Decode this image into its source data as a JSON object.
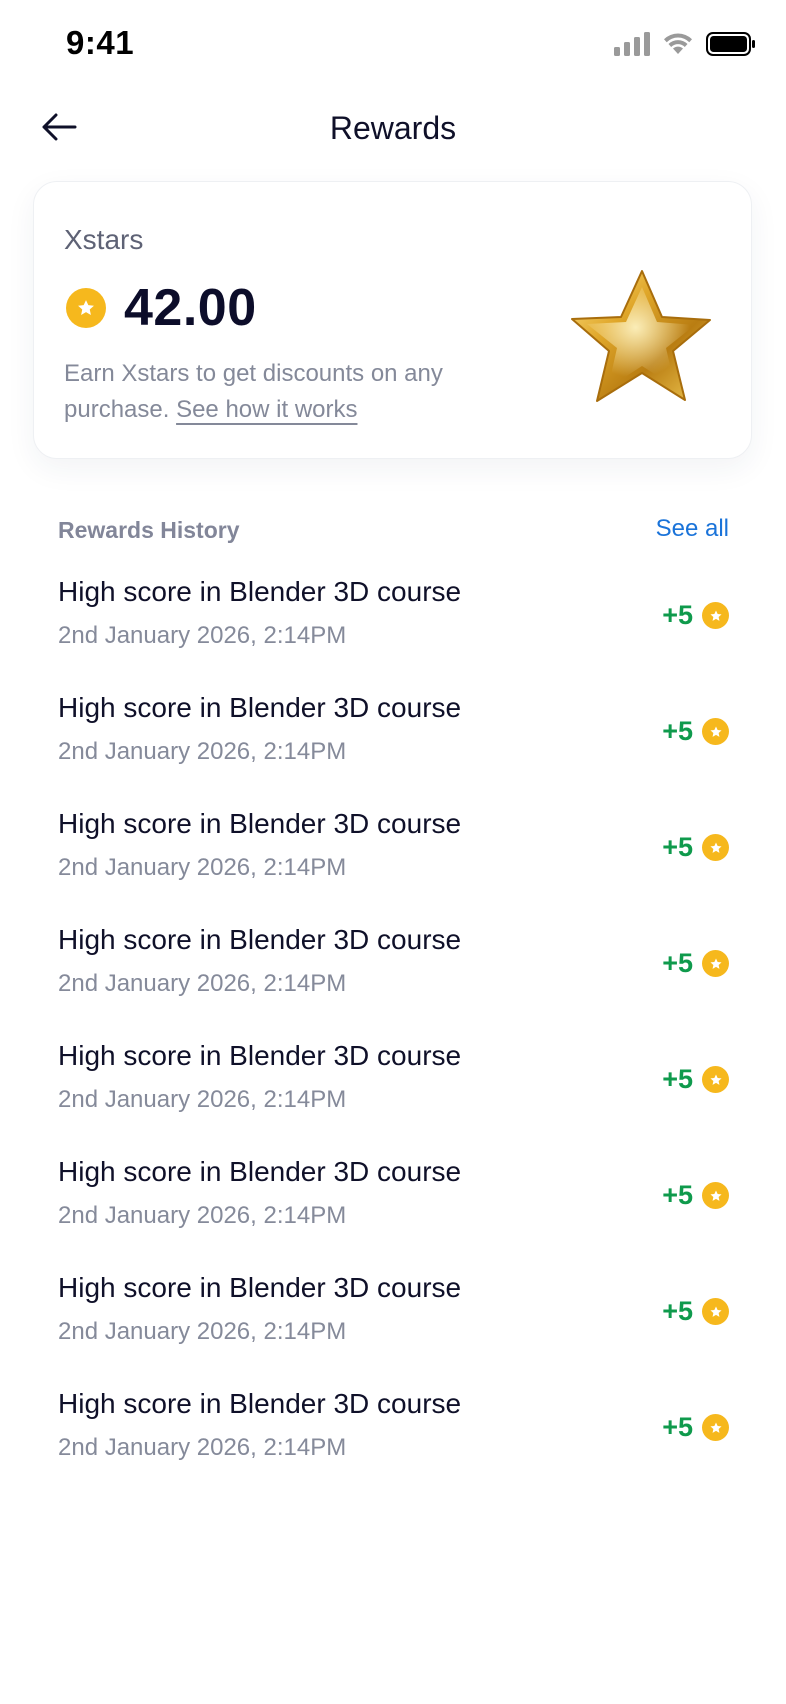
{
  "status_bar": {
    "time": "9:41",
    "icons": [
      "cellular-signal-icon",
      "wifi-icon",
      "battery-icon"
    ]
  },
  "nav": {
    "back_icon": "arrow-left-icon",
    "title": "Rewards"
  },
  "balance_card": {
    "label": "Xstars",
    "coin_icon": "star-coin-icon",
    "amount": "42.00",
    "description": "Earn Xstars to get discounts on any purchase.",
    "link_text": "See how it works",
    "illustration": "gold-star-3d-icon"
  },
  "history": {
    "title": "Rewards History",
    "see_all_label": "See all",
    "items": [
      {
        "title": "High score in Blender 3D course",
        "date": "2nd January 2026, 2:14PM",
        "amount": "+5"
      },
      {
        "title": "High score in Blender 3D course",
        "date": "2nd January 2026, 2:14PM",
        "amount": "+5"
      },
      {
        "title": "High score in Blender 3D course",
        "date": "2nd January 2026, 2:14PM",
        "amount": "+5"
      },
      {
        "title": "High score in Blender 3D course",
        "date": "2nd January 2026, 2:14PM",
        "amount": "+5"
      },
      {
        "title": "High score in Blender 3D course",
        "date": "2nd January 2026, 2:14PM",
        "amount": "+5"
      },
      {
        "title": "High score in Blender 3D course",
        "date": "2nd January 2026, 2:14PM",
        "amount": "+5"
      },
      {
        "title": "High score in Blender 3D course",
        "date": "2nd January 2026, 2:14PM",
        "amount": "+5"
      },
      {
        "title": "High score in Blender 3D course",
        "date": "2nd January 2026, 2:14PM",
        "amount": "+5"
      }
    ]
  },
  "colors": {
    "accent_link": "#1a73d9",
    "reward_green": "#0f9a4c",
    "coin_gold": "#f6b81d",
    "primary_text": "#0f1029",
    "secondary_text": "#858a9a"
  }
}
